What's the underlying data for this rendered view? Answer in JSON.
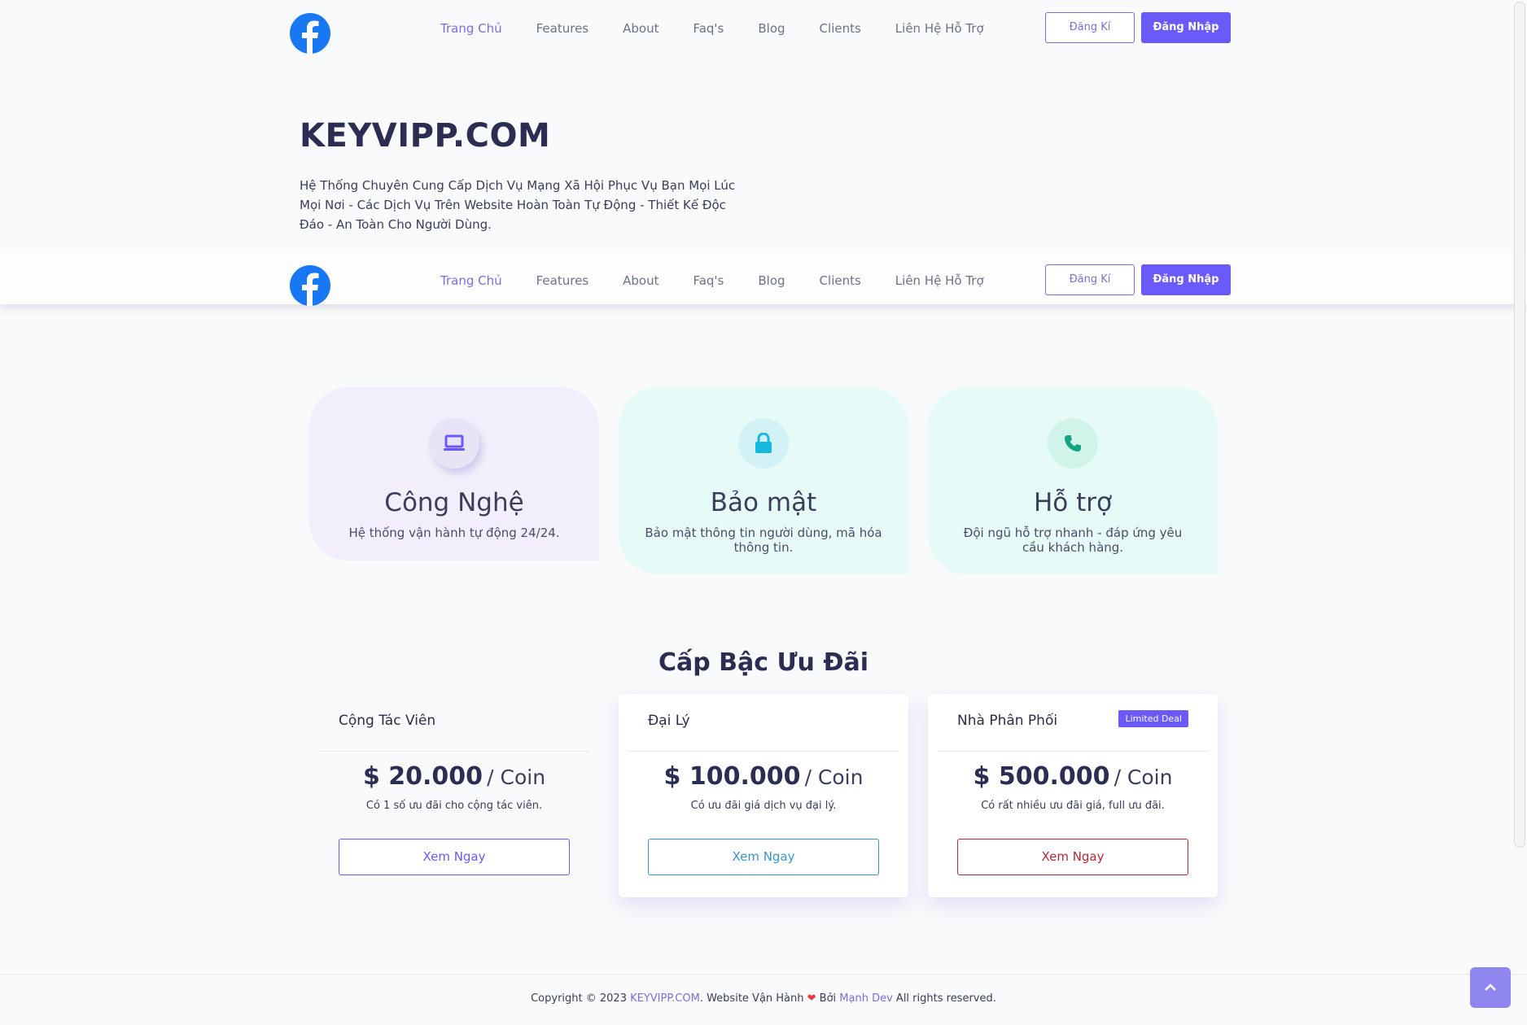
{
  "nav": {
    "items": [
      {
        "label": "Trang Chủ",
        "active": true
      },
      {
        "label": "Features",
        "active": false
      },
      {
        "label": "About",
        "active": false
      },
      {
        "label": "Faq's",
        "active": false
      },
      {
        "label": "Blog",
        "active": false
      },
      {
        "label": "Clients",
        "active": false
      },
      {
        "label": "Liên Hệ Hỗ Trợ",
        "active": false
      }
    ],
    "register_label": "Đăng Kí",
    "login_label": "Đăng Nhập"
  },
  "hero": {
    "title": "KEYVIPP.COM",
    "description": "Hệ Thống Chuyên Cung Cấp Dịch Vụ Mạng Xã Hội Phục Vụ Bạn Mọi Lúc Mọi Nơi - Các Dịch Vụ Trên Website Hoàn Toàn Tự Động - Thiết Kế Độc Đáo - An Toàn Cho Người Dùng."
  },
  "features": [
    {
      "icon": "laptop-icon",
      "title": "Công Nghệ",
      "text": "Hệ thống vận hành tự động 24/24.",
      "color": "#6a5af9"
    },
    {
      "icon": "lock-icon",
      "title": "Bảo mật",
      "text": "Bảo mật thông tin người dùng, mã hóa thông tin.",
      "color": "#16b8e0"
    },
    {
      "icon": "phone-icon",
      "title": "Hỗ trợ",
      "text": "Đội ngũ hỗ trợ nhanh - đáp ứng yêu cầu khách hàng.",
      "color": "#14a37f"
    }
  ],
  "pricing": {
    "title": "Cấp Bậc Ưu Đãi",
    "plans": [
      {
        "name": "Cộng Tác Viên",
        "amount": "$ 20.000",
        "unit": "/ Coin",
        "note": "Có 1 số ưu đãi cho cộng tác viên.",
        "cta": "Xem Ngay",
        "cta_color": "#6a5af9"
      },
      {
        "name": "Đại Lý",
        "amount": "$ 100.000",
        "unit": "/ Coin",
        "note": "Có ưu đãi giá dịch vụ đại lý.",
        "cta": "Xem Ngay",
        "cta_color": "#3a93c9"
      },
      {
        "name": "Nhà Phân Phối",
        "badge": "Limited Deal",
        "amount": "$ 500.000",
        "unit": "/ Coin",
        "note": "Có rất nhiều ưu đãi giá, full ưu đãi.",
        "cta": "Xem Ngay",
        "cta_color": "#b02a37"
      }
    ]
  },
  "footer": {
    "prefix": "Copyright © 2023 ",
    "brand": "KEYVIPP.COM",
    "middle": ". Website Vận Hành ",
    "by": " Bởi ",
    "author": "Mạnh Dev",
    "suffix": " All rights reserved."
  }
}
